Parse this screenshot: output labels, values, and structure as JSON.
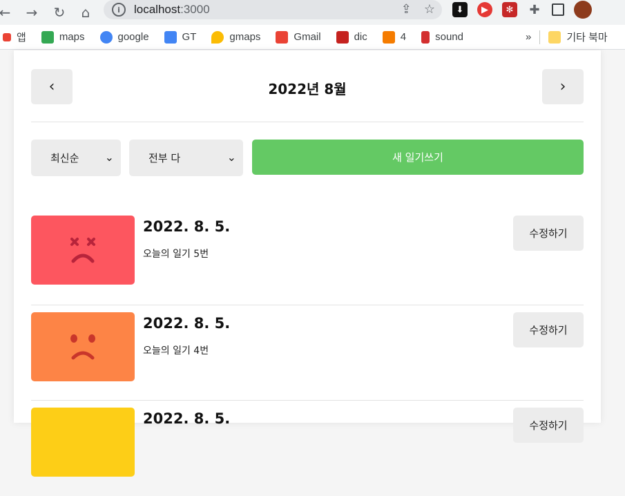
{
  "browser": {
    "url_host": "localhost",
    "url_port": ":3000",
    "bookmarks": [
      {
        "label": "앱",
        "color": "#ea4335"
      },
      {
        "label": "maps",
        "color": "#34a853"
      },
      {
        "label": "google",
        "color": "#4285f4"
      },
      {
        "label": "GT",
        "color": "#4285f4"
      },
      {
        "label": "gmaps",
        "color": "#fbbc04"
      },
      {
        "label": "Gmail",
        "color": "#ea4335"
      },
      {
        "label": "dic",
        "color": "#c5221f"
      },
      {
        "label": "4",
        "color": "#f57c00"
      },
      {
        "label": "sound",
        "color": "#d32f2f"
      }
    ],
    "more_label": "»",
    "other_bookmarks": "기타 북마"
  },
  "header": {
    "title": "2022년 8월",
    "prev_label": "‹",
    "next_label": "›"
  },
  "controls": {
    "sort_value": "최신순",
    "filter_value": "전부 다",
    "new_button": "새 일기쓰기"
  },
  "diaries": [
    {
      "date": "2022. 8. 5.",
      "content": "오늘의 일기 5번",
      "edit": "수정하기",
      "emotion": "angry",
      "color": "#fd565f"
    },
    {
      "date": "2022. 8. 5.",
      "content": "오늘의 일기 4번",
      "edit": "수정하기",
      "emotion": "sad",
      "color": "#fd8446"
    },
    {
      "date": "2022. 8. 5.",
      "content": "",
      "edit": "수정하기",
      "emotion": "normal",
      "color": "#fdce17"
    }
  ]
}
